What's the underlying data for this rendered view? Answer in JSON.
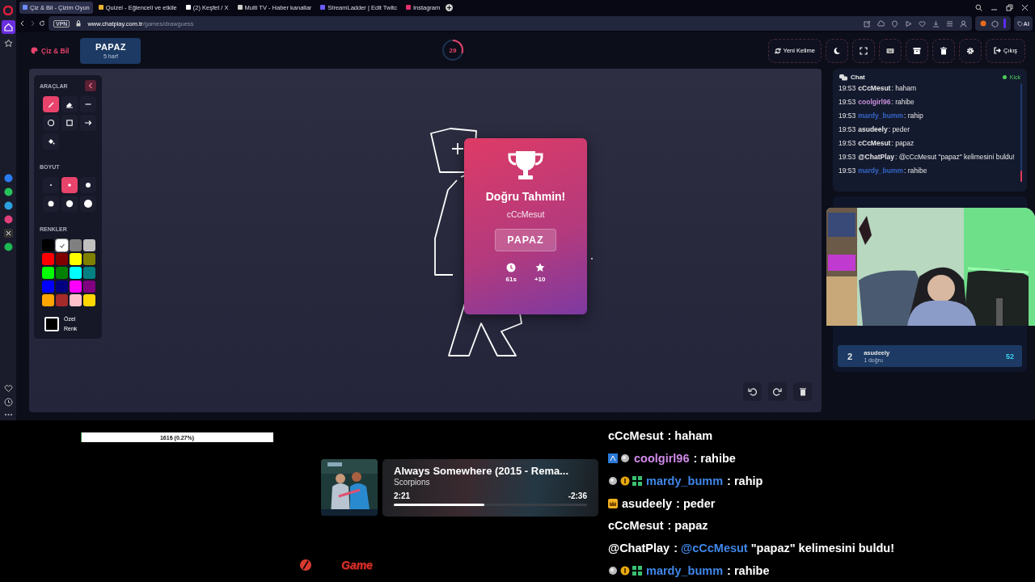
{
  "browser": {
    "tabs": [
      {
        "label": "Çiz & Bil - Çizim Oyun",
        "selected": true
      },
      {
        "label": "Quizei - Eğlenceli ve etkile",
        "selected": false
      },
      {
        "label": "(2) Keşfet / X",
        "selected": false
      },
      {
        "label": "Multi TV - Haber kanallar",
        "selected": false
      },
      {
        "label": "StreamLadder | Edit Twitc",
        "selected": false
      },
      {
        "label": "Instagram",
        "selected": false
      }
    ],
    "vpn": "VPN",
    "url_host": "www.chatplay.com.tr",
    "url_path": "/games/drawguess",
    "ai": "AI"
  },
  "header": {
    "logo": "Çiz & Bil",
    "word": "PAPAZ",
    "hint": "5 harf",
    "timer": {
      "value": "29",
      "level": 0.3
    },
    "new_word": "Yeni Kelime",
    "exit": "Çıkış"
  },
  "tools": {
    "title": "ARAÇLAR",
    "items": [
      {
        "selected": true
      },
      {
        "selected": false
      },
      {
        "selected": false
      },
      {
        "selected": false
      },
      {
        "selected": false
      },
      {
        "selected": false
      },
      {
        "selected": false
      }
    ],
    "size_title": "BOYUT",
    "sizes": [
      {
        "selected": false
      },
      {
        "selected": true
      },
      {
        "selected": false
      },
      {
        "selected": false
      },
      {
        "selected": false
      },
      {
        "selected": false
      }
    ],
    "colors_title": "RENKLER",
    "colors": [
      {
        "color": "#000000",
        "selected": false
      },
      {
        "color": "#ffffff",
        "selected": true
      },
      {
        "color": "#808080",
        "selected": false
      },
      {
        "color": "#c0c0c0",
        "selected": false
      },
      {
        "color": "#ff0000",
        "selected": false
      },
      {
        "color": "#800000",
        "selected": false
      },
      {
        "color": "#ffff00",
        "selected": false
      },
      {
        "color": "#808000",
        "selected": false
      },
      {
        "color": "#00ff00",
        "selected": false
      },
      {
        "color": "#008000",
        "selected": false
      },
      {
        "color": "#00ffff",
        "selected": false
      },
      {
        "color": "#008080",
        "selected": false
      },
      {
        "color": "#0000ff",
        "selected": false
      },
      {
        "color": "#000080",
        "selected": false
      },
      {
        "color": "#ff00ff",
        "selected": false
      },
      {
        "color": "#800080",
        "selected": false
      },
      {
        "color": "#ffa500",
        "selected": false
      },
      {
        "color": "#a52a2a",
        "selected": false
      },
      {
        "color": "#ffc0cb",
        "selected": false
      },
      {
        "color": "#ffd700",
        "selected": false
      }
    ],
    "custom_label": "Özel Renk"
  },
  "result": {
    "title": "Doğru Tahmin!",
    "player": "cCcMesut",
    "word": "PAPAZ",
    "time": "61s",
    "points": "+10"
  },
  "chat": {
    "title": "Chat",
    "platform": "Kick",
    "messages": [
      {
        "time": "19:53",
        "user": "cCcMesut",
        "color": "#e6e6e6",
        "text": ": haham"
      },
      {
        "time": "19:53",
        "user": "coolgirl96",
        "color": "#c58fd9",
        "text": ": rahibe"
      },
      {
        "time": "19:53",
        "user": "mardy_bumm",
        "color": "#3566c8",
        "text": ": rahip"
      },
      {
        "time": "19:53",
        "user": "asudeely",
        "color": "#e6e6e6",
        "text": ": peder"
      },
      {
        "time": "19:53",
        "user": "cCcMesut",
        "color": "#e6e6e6",
        "text": ": papaz"
      },
      {
        "time": "19:53",
        "user": "@ChatPlay",
        "color": "#e6e6e6",
        "text": ": @cCcMesut \"papaz\" kelimesini buldu!"
      },
      {
        "time": "19:53",
        "user": "mardy_bumm",
        "color": "#3566c8",
        "text": ": rahibe"
      }
    ]
  },
  "leaderboard": [
    {
      "rank": "2",
      "name": "asudeely",
      "detail": "1 doğru",
      "score": "52"
    }
  ],
  "overlay": {
    "donation": {
      "text": "161₺ (0.27%)",
      "level": 0.0027
    },
    "music": {
      "title": "Always Somewhere (2015 - Rema...",
      "artist": "Scorpions",
      "elapsed": "2:21",
      "remaining": "-2:36",
      "level": 0.47
    },
    "logo": "Game",
    "chat": [
      {
        "user": "cCcMesut",
        "color": "#ffffff",
        "text": ": haham"
      },
      {
        "user": "coolgirl96",
        "color": "#d08ae8",
        "badges": [
          {
            "kind": "pixel"
          },
          {
            "kind": "orb"
          }
        ],
        "text": ": rahibe"
      },
      {
        "user": "mardy_bumm",
        "color": "#3f86e8",
        "badges": [
          {
            "kind": "orb"
          },
          {
            "kind": "coin"
          },
          {
            "kind": "grid"
          }
        ],
        "text": ": rahip"
      },
      {
        "user": "asudeely",
        "color": "#ffffff",
        "badges": [
          {
            "kind": "crown"
          }
        ],
        "text": ": peder"
      },
      {
        "user": "cCcMesut",
        "color": "#ffffff",
        "text": ": papaz"
      },
      {
        "user": "@ChatPlay",
        "color": "#ffffff",
        "text": ":",
        "mention": "@cCcMesut",
        "after": "\"papaz\" kelimesini buldu!"
      },
      {
        "user": "mardy_bumm",
        "color": "#3f86e8",
        "badges": [
          {
            "kind": "orb"
          },
          {
            "kind": "coin"
          },
          {
            "kind": "grid"
          }
        ],
        "text": ": rahibe"
      }
    ]
  }
}
